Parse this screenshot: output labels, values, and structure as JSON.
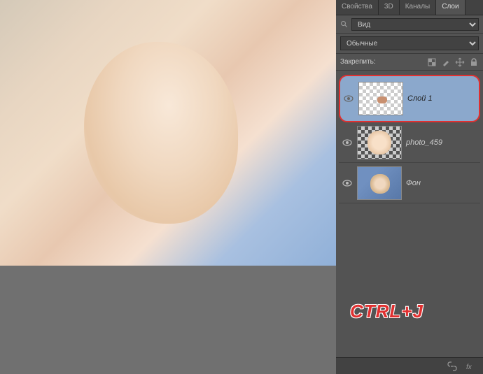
{
  "tabs": {
    "properties": "Свойства",
    "threeD": "3D",
    "channels": "Каналы",
    "layers": "Слои"
  },
  "search": {
    "placeholder": "Вид"
  },
  "blend": {
    "mode": "Обычные"
  },
  "lock": {
    "label": "Закрепить:"
  },
  "layers": [
    {
      "name": "Слой 1",
      "selected": true
    },
    {
      "name": "photo_459",
      "selected": false
    },
    {
      "name": "Фон",
      "selected": false
    }
  ],
  "hotkey": "CTRL+J"
}
